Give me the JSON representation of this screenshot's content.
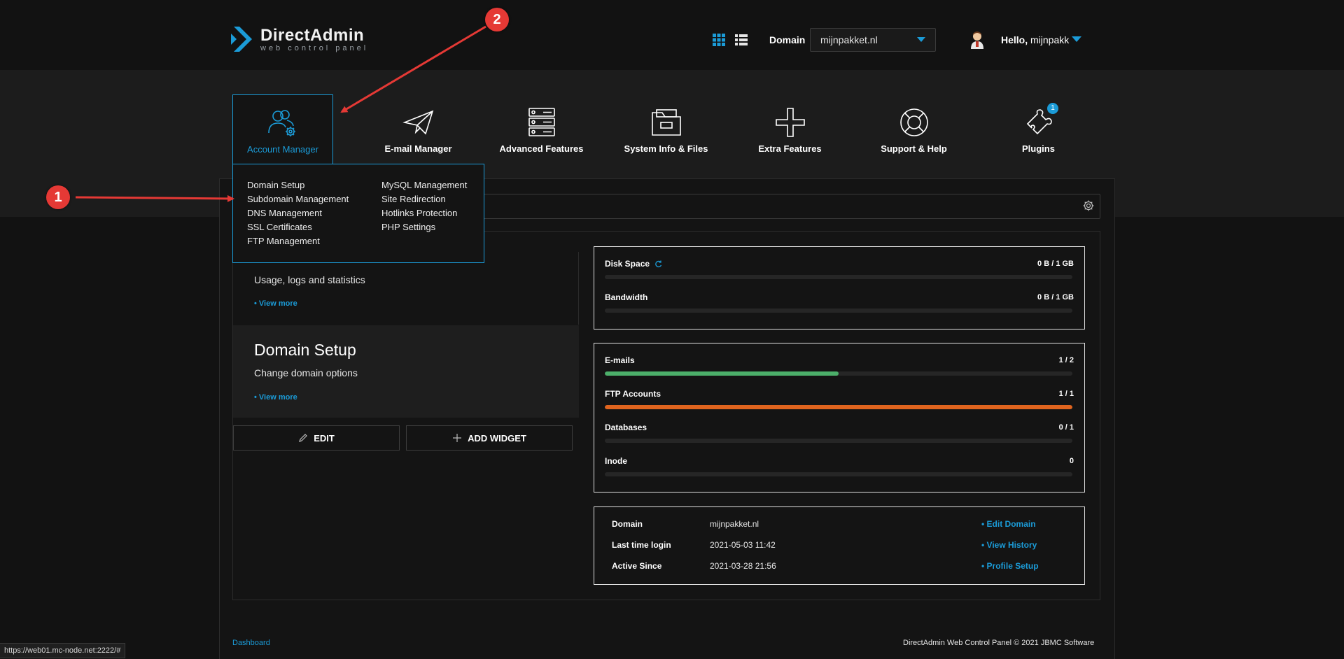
{
  "header": {
    "logo_name": "DirectAdmin",
    "logo_sub": "web control panel",
    "domain_label": "Domain",
    "domain_value": "mijnpakket.nl",
    "user_hello": "Hello,",
    "user_name": "mijnpakk"
  },
  "nav": {
    "items": [
      {
        "label": "Account Manager",
        "icon": "users-gear-icon"
      },
      {
        "label": "E-mail Manager",
        "icon": "paper-plane-icon"
      },
      {
        "label": "Advanced Features",
        "icon": "server-icon"
      },
      {
        "label": "System Info & Files",
        "icon": "folder-icon"
      },
      {
        "label": "Extra Features",
        "icon": "plus-icon"
      },
      {
        "label": "Support & Help",
        "icon": "lifebuoy-icon"
      },
      {
        "label": "Plugins",
        "icon": "puzzle-icon",
        "badge": "1"
      }
    ]
  },
  "dropdown": {
    "col1": [
      "Domain Setup",
      "Subdomain Management",
      "DNS Management",
      "SSL Certificates",
      "FTP Management"
    ],
    "col2": [
      "MySQL Management",
      "Site Redirection",
      "Hotlinks Protection",
      "PHP Settings"
    ]
  },
  "widgets": {
    "usage": {
      "desc": "Usage, logs and statistics",
      "more": "• View more"
    },
    "domain_setup": {
      "title": "Domain Setup",
      "desc": "Change domain options",
      "more": "• View more"
    },
    "edit": "EDIT",
    "add_widget": "ADD WIDGET"
  },
  "stats": {
    "disk_space": {
      "label": "Disk Space",
      "value": "0 B / 1 GB",
      "fraction": 0
    },
    "bandwidth": {
      "label": "Bandwidth",
      "value": "0 B / 1 GB",
      "fraction": 0
    },
    "emails": {
      "label": "E-mails",
      "value": "1 / 2",
      "fraction": 0.5
    },
    "ftp": {
      "label": "FTP Accounts",
      "value": "1 / 1",
      "fraction": 1
    },
    "databases": {
      "label": "Databases",
      "value": "0 / 1",
      "fraction": 0
    },
    "inode": {
      "label": "Inode",
      "value": "0",
      "fraction": 0
    }
  },
  "info": {
    "domain_k": "Domain",
    "domain_v": "mijnpakket.nl",
    "domain_link": "• Edit Domain",
    "login_k": "Last time login",
    "login_v": "2021-05-03 11:42",
    "login_link": "• View History",
    "since_k": "Active Since",
    "since_v": "2021-03-28 21:56",
    "since_link": "• Profile Setup"
  },
  "footer": {
    "left": "Dashboard",
    "right": "DirectAdmin Web Control Panel © 2021 JBMC Software"
  },
  "statusbar": "https://web01.mc-node.net:2222/#",
  "annotations": {
    "one": "1",
    "two": "2"
  },
  "colors": {
    "accent": "#1b9bd7",
    "green": "#4caf6a",
    "orange": "#e0641e",
    "annotation": "#e53935"
  }
}
